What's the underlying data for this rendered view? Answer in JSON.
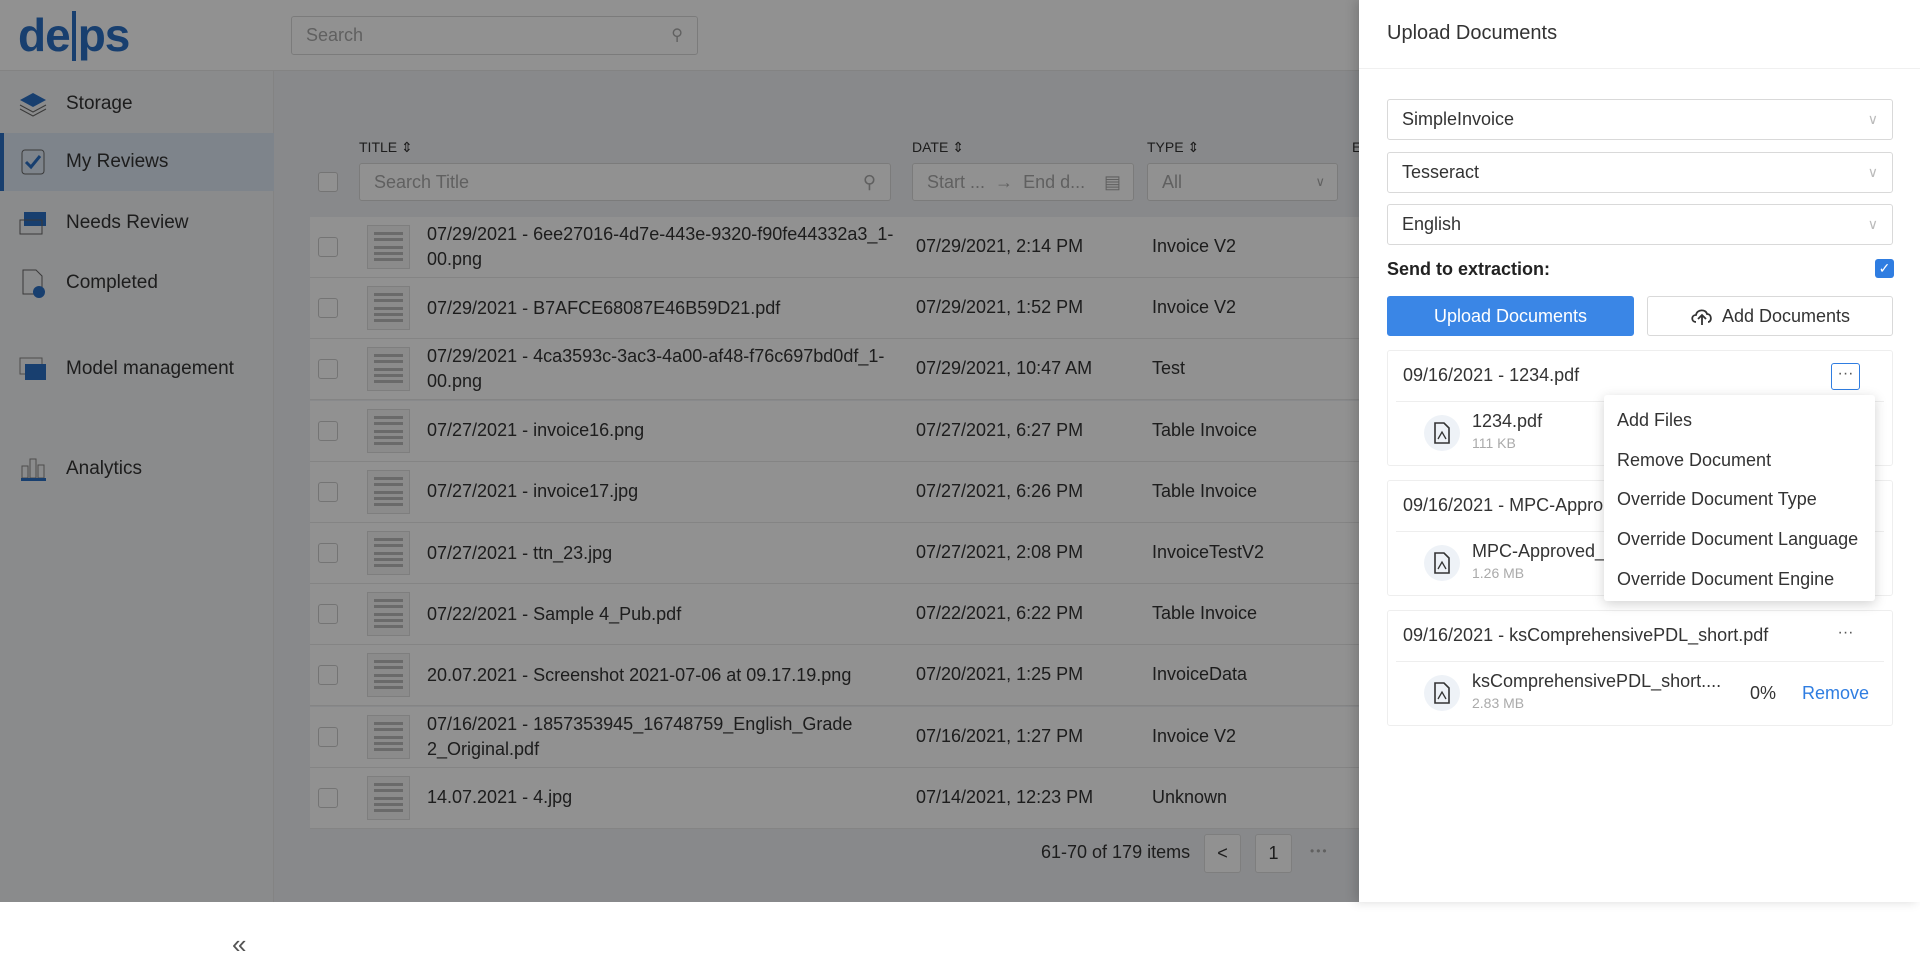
{
  "header": {
    "logo": "delps",
    "search_placeholder": "Search"
  },
  "sidebar": {
    "items": [
      {
        "label": "Storage",
        "icon": "layers-icon"
      },
      {
        "label": "My Reviews",
        "icon": "checkbox-icon",
        "active": true
      },
      {
        "label": "Needs Review",
        "icon": "folder-icon"
      },
      {
        "label": "Completed",
        "icon": "document-check-icon"
      },
      {
        "label": "Model management",
        "icon": "stack-icon"
      },
      {
        "label": "Analytics",
        "icon": "bar-chart-icon"
      }
    ],
    "collapse": "«"
  },
  "table": {
    "columns": {
      "title": "TITLE",
      "date": "DATE",
      "type": "TYPE",
      "extra": "E"
    },
    "filters": {
      "title_placeholder": "Search Title",
      "date_start": "Start ...",
      "date_end": "End d...",
      "type_value": "All"
    },
    "rows": [
      {
        "title": "07/29/2021 - 6ee27016-4d7e-443e-9320-f90fe44332a3_1-00.png",
        "date": "07/29/2021, 2:14 PM",
        "type": "Invoice V2"
      },
      {
        "title": "07/29/2021 - B7AFCE68087E46B59D21.pdf",
        "date": "07/29/2021, 1:52 PM",
        "type": "Invoice V2"
      },
      {
        "title": "07/29/2021 - 4ca3593c-3ac3-4a00-af48-f76c697bd0df_1-00.png",
        "date": "07/29/2021, 10:47 AM",
        "type": "Test"
      },
      {
        "title": "07/27/2021 - invoice16.png",
        "date": "07/27/2021, 6:27 PM",
        "type": "Table Invoice"
      },
      {
        "title": "07/27/2021 - invoice17.jpg",
        "date": "07/27/2021, 6:26 PM",
        "type": "Table Invoice"
      },
      {
        "title": "07/27/2021 - ttn_23.jpg",
        "date": "07/27/2021, 2:08 PM",
        "type": "InvoiceTestV2"
      },
      {
        "title": "07/22/2021 - Sample 4_Pub.pdf",
        "date": "07/22/2021, 6:22 PM",
        "type": "Table Invoice"
      },
      {
        "title": "20.07.2021 - Screenshot 2021-07-06 at 09.17.19.png",
        "date": "07/20/2021, 1:25 PM",
        "type": "InvoiceData"
      },
      {
        "title": "07/16/2021 - 1857353945_16748759_English_Grade 2_Original.pdf",
        "date": "07/16/2021, 1:27 PM",
        "type": "Invoice V2"
      },
      {
        "title": "14.07.2021 - 4.jpg",
        "date": "07/14/2021, 12:23 PM",
        "type": "Unknown"
      }
    ],
    "pagination": {
      "info": "61-70 of 179 items",
      "prev": "<",
      "page": "1",
      "ellipsis": "•••"
    }
  },
  "panel": {
    "title": "Upload Documents",
    "document_type": "SimpleInvoice",
    "engine": "Tesseract",
    "language": "English",
    "send_label": "Send to extraction:",
    "send_checked": true,
    "upload_button": "Upload Documents",
    "add_button": "Add Documents",
    "accent": "#3a86e6",
    "documents": [
      {
        "header": "09/16/2021 - 1234.pdf",
        "file": "1234.pdf",
        "size": "111 KB"
      },
      {
        "header": "09/16/2021 - MPC-Appro",
        "file": "MPC-Approved_",
        "size": "1.26 MB"
      },
      {
        "header": "09/16/2021 - ksComprehensivePDL_short.pdf",
        "file": "ksComprehensivePDL_short....",
        "size": "2.83 MB",
        "progress": "0%",
        "remove": "Remove"
      }
    ],
    "more": "···",
    "menu": [
      "Add Files",
      "Remove Document",
      "Override Document Type",
      "Override Document Language",
      "Override Document Engine"
    ]
  }
}
